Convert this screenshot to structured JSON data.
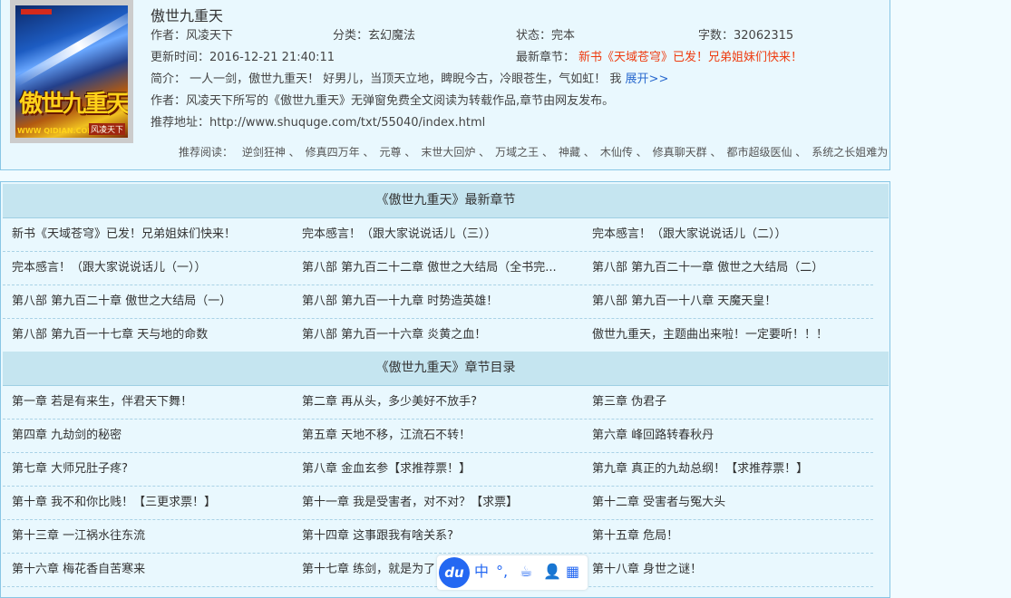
{
  "book": {
    "title": "傲世九重天",
    "author": "作者：风凌天下",
    "category": "分类：玄幻魔法",
    "status": "状态：完本",
    "word_count": "字数：32062315",
    "updated": "更新时间：2016-12-21 21:40:11",
    "latest_label": "最新章节：",
    "latest_chapter": "新书《天域苍穹》已发！兄弟姐妹们快来！",
    "intro": "简介：  一人一剑，傲世九重天！ 好男儿，当顶天立地，睥睨今古，冷眼苍生，气如虹！ 我",
    "expand_label": "展开>>",
    "author_note": "作者：风凌天下所写的《傲世九重天》无弹窗免费全文阅读为转载作品,章节由网友发布。",
    "recommend_url": "推荐地址：http://www.shuquge.com/txt/55040/index.html",
    "cover": {
      "title_art": "傲世九重天",
      "footer_left": "WWW QIDIAN.COM",
      "footer_right": "风凌天下"
    }
  },
  "recommend": {
    "label": "推荐阅读：",
    "items": [
      "逆剑狂神 、",
      "修真四万年 、",
      "元尊 、",
      "末世大回炉 、",
      "万域之王 、",
      "神藏 、",
      "木仙传 、",
      "修真聊天群 、",
      "都市超级医仙 、",
      "系统之长姐难为"
    ]
  },
  "latest_section": {
    "header": "《傲世九重天》最新章节",
    "rows": [
      [
        "新书《天域苍穹》已发！兄弟姐妹们快来！",
        "完本感言！（跟大家说说话儿（三））",
        "完本感言！（跟大家说说话儿（二））"
      ],
      [
        "完本感言！（跟大家说说话儿（一））",
        "第八部 第九百二十二章 傲世之大结局（全书完...",
        "第八部 第九百二十一章 傲世之大结局（二）"
      ],
      [
        "第八部 第九百二十章 傲世之大结局（一）",
        "第八部 第九百一十九章 时势造英雄！",
        "第八部 第九百一十八章 天魔天皇！"
      ],
      [
        "第八部 第九百一十七章 天与地的命数",
        "第八部 第九百一十六章 炎黄之血！",
        "傲世九重天，主题曲出来啦！一定要听！！！"
      ]
    ]
  },
  "toc_section": {
    "header": "《傲世九重天》章节目录",
    "rows": [
      [
        "第一章 若是有来生，伴君天下舞！",
        "第二章 再从头，多少美好不放手?",
        "第三章 伪君子"
      ],
      [
        "第四章 九劫剑的秘密",
        "第五章 天地不移，江流石不转！",
        "第六章 峰回路转春秋丹"
      ],
      [
        "第七章 大师兄肚子疼?",
        "第八章 金血玄参【求推荐票！】",
        "第九章 真正的九劫总纲！【求推荐票！】"
      ],
      [
        "第十章 我不和你比贱！【三更求票！】",
        "第十一章 我是受害者，对不对？【求票】",
        "第十二章 受害者与冤大头"
      ],
      [
        "第十三章 一江祸水往东流",
        "第十四章 这事跟我有啥关系?",
        "第十五章 危局！"
      ],
      [
        "第十六章 梅花香自苦寒来",
        "第十七章 练剑，就是为了",
        "第十八章 身世之谜！"
      ]
    ]
  },
  "ime_toolbar": {
    "logo": "du",
    "items": [
      "中",
      "°,",
      "☕",
      "👤",
      "▦"
    ]
  },
  "colors": {
    "page_bg": "#f1fbff",
    "panel_bg": "#e9f8fe",
    "border": "#88c6e5",
    "header_bg": "#c5e5f0",
    "latest_link": "#ee3c10",
    "expand_link": "#2a6acf",
    "ime_blue": "#2468f2"
  }
}
